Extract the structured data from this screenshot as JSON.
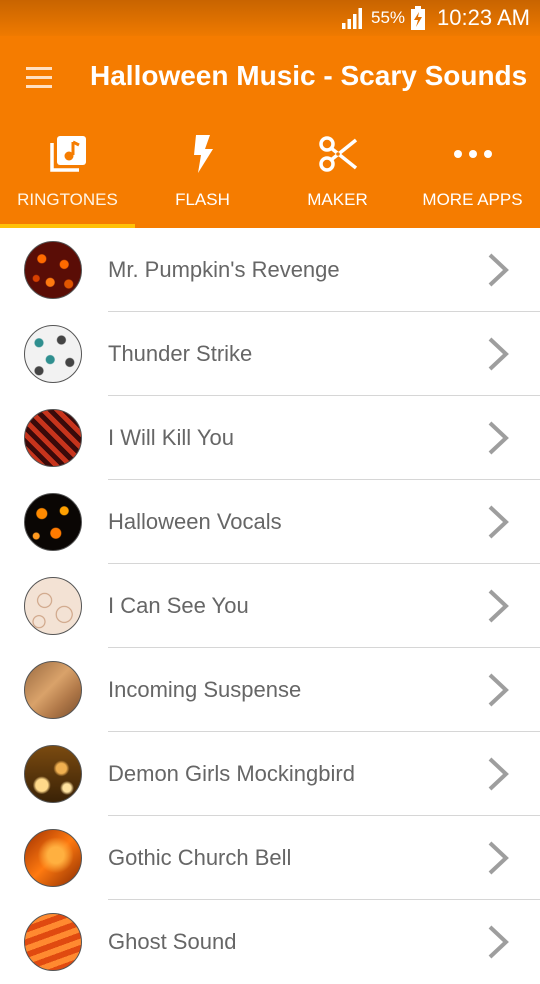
{
  "status_bar": {
    "battery_percent": "55%",
    "time": "10:23 AM",
    "signal_icon": "signal-icon",
    "battery_icon": "battery-charging-icon"
  },
  "toolbar": {
    "menu_icon": "hamburger-menu-icon",
    "title": "Halloween Music - Scary Sounds"
  },
  "tabs": [
    {
      "label": "RINGTONES",
      "icon": "music-library-icon",
      "active": true
    },
    {
      "label": "FLASH",
      "icon": "lightning-bolt-icon",
      "active": false
    },
    {
      "label": "MAKER",
      "icon": "scissors-icon",
      "active": false
    },
    {
      "label": "MORE APPS",
      "icon": "more-dots-icon",
      "active": false
    }
  ],
  "ringtones": [
    {
      "name": "Mr. Pumpkin's Revenge"
    },
    {
      "name": "Thunder Strike"
    },
    {
      "name": "I Will Kill You"
    },
    {
      "name": "Halloween Vocals"
    },
    {
      "name": "I Can See You"
    },
    {
      "name": "Incoming Suspense"
    },
    {
      "name": "Demon Girls Mockingbird"
    },
    {
      "name": "Gothic Church Bell"
    },
    {
      "name": "Ghost Sound"
    }
  ],
  "colors": {
    "accent": "#f57c00",
    "tab_indicator": "#ffc107",
    "text": "#666666",
    "chevron": "#9e9e9e"
  }
}
